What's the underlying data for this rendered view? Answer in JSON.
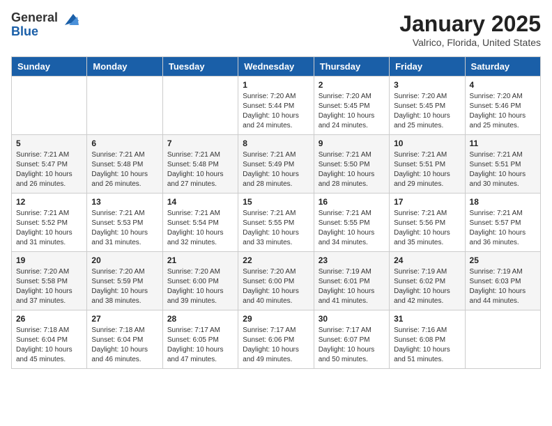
{
  "logo": {
    "general": "General",
    "blue": "Blue"
  },
  "title": "January 2025",
  "location": "Valrico, Florida, United States",
  "weekdays": [
    "Sunday",
    "Monday",
    "Tuesday",
    "Wednesday",
    "Thursday",
    "Friday",
    "Saturday"
  ],
  "weeks": [
    [
      {
        "day": "",
        "info": ""
      },
      {
        "day": "",
        "info": ""
      },
      {
        "day": "",
        "info": ""
      },
      {
        "day": "1",
        "info": "Sunrise: 7:20 AM\nSunset: 5:44 PM\nDaylight: 10 hours\nand 24 minutes."
      },
      {
        "day": "2",
        "info": "Sunrise: 7:20 AM\nSunset: 5:45 PM\nDaylight: 10 hours\nand 24 minutes."
      },
      {
        "day": "3",
        "info": "Sunrise: 7:20 AM\nSunset: 5:45 PM\nDaylight: 10 hours\nand 25 minutes."
      },
      {
        "day": "4",
        "info": "Sunrise: 7:20 AM\nSunset: 5:46 PM\nDaylight: 10 hours\nand 25 minutes."
      }
    ],
    [
      {
        "day": "5",
        "info": "Sunrise: 7:21 AM\nSunset: 5:47 PM\nDaylight: 10 hours\nand 26 minutes."
      },
      {
        "day": "6",
        "info": "Sunrise: 7:21 AM\nSunset: 5:48 PM\nDaylight: 10 hours\nand 26 minutes."
      },
      {
        "day": "7",
        "info": "Sunrise: 7:21 AM\nSunset: 5:48 PM\nDaylight: 10 hours\nand 27 minutes."
      },
      {
        "day": "8",
        "info": "Sunrise: 7:21 AM\nSunset: 5:49 PM\nDaylight: 10 hours\nand 28 minutes."
      },
      {
        "day": "9",
        "info": "Sunrise: 7:21 AM\nSunset: 5:50 PM\nDaylight: 10 hours\nand 28 minutes."
      },
      {
        "day": "10",
        "info": "Sunrise: 7:21 AM\nSunset: 5:51 PM\nDaylight: 10 hours\nand 29 minutes."
      },
      {
        "day": "11",
        "info": "Sunrise: 7:21 AM\nSunset: 5:51 PM\nDaylight: 10 hours\nand 30 minutes."
      }
    ],
    [
      {
        "day": "12",
        "info": "Sunrise: 7:21 AM\nSunset: 5:52 PM\nDaylight: 10 hours\nand 31 minutes."
      },
      {
        "day": "13",
        "info": "Sunrise: 7:21 AM\nSunset: 5:53 PM\nDaylight: 10 hours\nand 31 minutes."
      },
      {
        "day": "14",
        "info": "Sunrise: 7:21 AM\nSunset: 5:54 PM\nDaylight: 10 hours\nand 32 minutes."
      },
      {
        "day": "15",
        "info": "Sunrise: 7:21 AM\nSunset: 5:55 PM\nDaylight: 10 hours\nand 33 minutes."
      },
      {
        "day": "16",
        "info": "Sunrise: 7:21 AM\nSunset: 5:55 PM\nDaylight: 10 hours\nand 34 minutes."
      },
      {
        "day": "17",
        "info": "Sunrise: 7:21 AM\nSunset: 5:56 PM\nDaylight: 10 hours\nand 35 minutes."
      },
      {
        "day": "18",
        "info": "Sunrise: 7:21 AM\nSunset: 5:57 PM\nDaylight: 10 hours\nand 36 minutes."
      }
    ],
    [
      {
        "day": "19",
        "info": "Sunrise: 7:20 AM\nSunset: 5:58 PM\nDaylight: 10 hours\nand 37 minutes."
      },
      {
        "day": "20",
        "info": "Sunrise: 7:20 AM\nSunset: 5:59 PM\nDaylight: 10 hours\nand 38 minutes."
      },
      {
        "day": "21",
        "info": "Sunrise: 7:20 AM\nSunset: 6:00 PM\nDaylight: 10 hours\nand 39 minutes."
      },
      {
        "day": "22",
        "info": "Sunrise: 7:20 AM\nSunset: 6:00 PM\nDaylight: 10 hours\nand 40 minutes."
      },
      {
        "day": "23",
        "info": "Sunrise: 7:19 AM\nSunset: 6:01 PM\nDaylight: 10 hours\nand 41 minutes."
      },
      {
        "day": "24",
        "info": "Sunrise: 7:19 AM\nSunset: 6:02 PM\nDaylight: 10 hours\nand 42 minutes."
      },
      {
        "day": "25",
        "info": "Sunrise: 7:19 AM\nSunset: 6:03 PM\nDaylight: 10 hours\nand 44 minutes."
      }
    ],
    [
      {
        "day": "26",
        "info": "Sunrise: 7:18 AM\nSunset: 6:04 PM\nDaylight: 10 hours\nand 45 minutes."
      },
      {
        "day": "27",
        "info": "Sunrise: 7:18 AM\nSunset: 6:04 PM\nDaylight: 10 hours\nand 46 minutes."
      },
      {
        "day": "28",
        "info": "Sunrise: 7:17 AM\nSunset: 6:05 PM\nDaylight: 10 hours\nand 47 minutes."
      },
      {
        "day": "29",
        "info": "Sunrise: 7:17 AM\nSunset: 6:06 PM\nDaylight: 10 hours\nand 49 minutes."
      },
      {
        "day": "30",
        "info": "Sunrise: 7:17 AM\nSunset: 6:07 PM\nDaylight: 10 hours\nand 50 minutes."
      },
      {
        "day": "31",
        "info": "Sunrise: 7:16 AM\nSunset: 6:08 PM\nDaylight: 10 hours\nand 51 minutes."
      },
      {
        "day": "",
        "info": ""
      }
    ]
  ]
}
